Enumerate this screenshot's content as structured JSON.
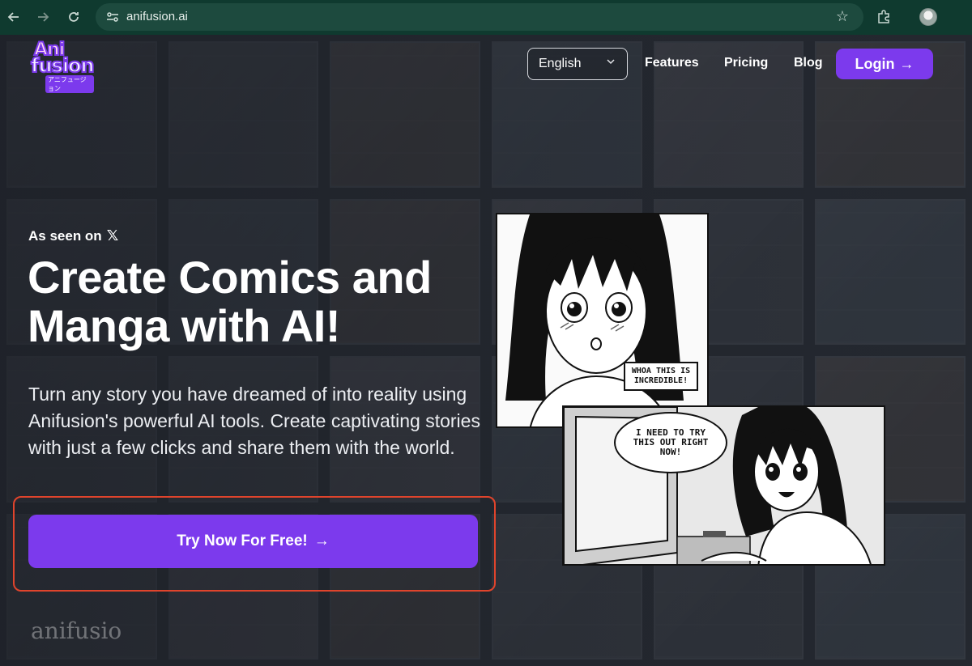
{
  "browser": {
    "url": "anifusion.ai",
    "icons": [
      "back-arrow-icon",
      "forward-arrow-icon",
      "reload-icon",
      "site-settings-icon",
      "bookmark-star-icon",
      "extensions-icon",
      "profile-avatar"
    ]
  },
  "logo": {
    "line1": "Ani",
    "line2": "fusion",
    "tagline": "アニフュージョン"
  },
  "nav": {
    "language": "English",
    "links": [
      "Features",
      "Pricing",
      "Blog"
    ],
    "login": "Login"
  },
  "hero": {
    "seen_on": "As seen on",
    "headline": "Create Comics and Manga with AI!",
    "subtitle": "Turn any story you have dreamed of into reality using Anifusion's powerful AI tools. Create captivating stories with just a few clicks and share them with the world.",
    "cta": "Try Now For Free!"
  },
  "comics": {
    "bubble1": "WHOA THIS IS INCREDIBLE!",
    "bubble2": "I NEED TO TRY THIS OUT RIGHT NOW!"
  },
  "watermark": "anifusio",
  "colors": {
    "accent": "#7c3aed",
    "highlight": "#e0442c",
    "chrome": "#0f3a2f"
  }
}
